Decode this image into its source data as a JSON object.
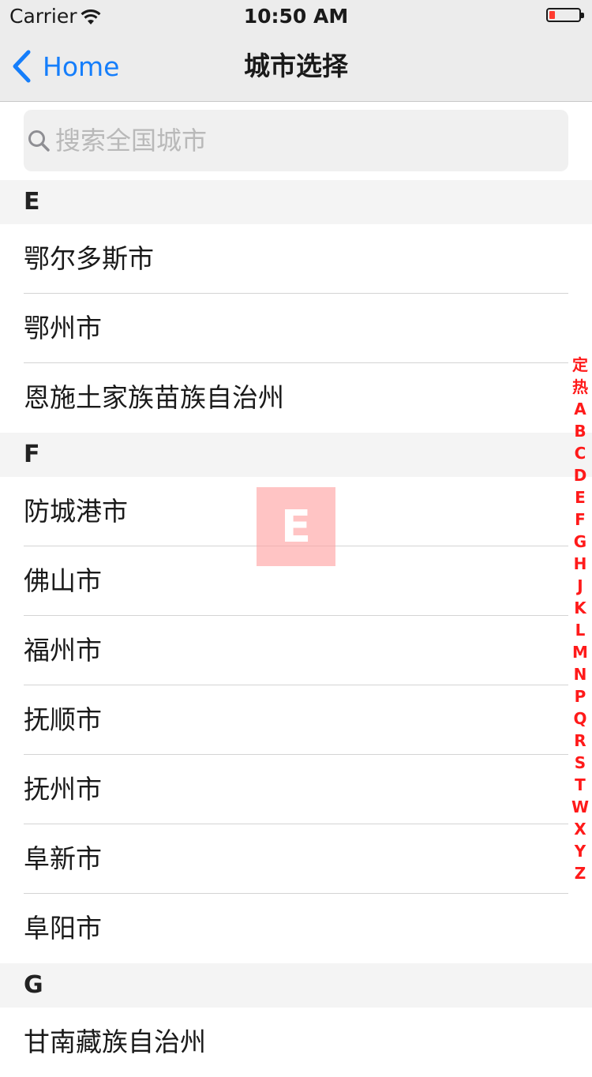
{
  "status_bar": {
    "carrier": "Carrier",
    "time": "10:50 AM",
    "battery_level_percent": 20,
    "battery_color": "#ff3b30"
  },
  "nav": {
    "back_label": "Home",
    "title": "城市选择",
    "accent_color": "#157efb"
  },
  "search": {
    "placeholder": "搜索全国城市",
    "value": ""
  },
  "sections": [
    {
      "letter": "E",
      "cities": [
        "鄂尔多斯市",
        "鄂州市",
        "恩施土家族苗族自治州"
      ]
    },
    {
      "letter": "F",
      "cities": [
        "防城港市",
        "佛山市",
        "福州市",
        "抚顺市",
        "抚州市",
        "阜新市",
        "阜阳市"
      ]
    },
    {
      "letter": "G",
      "cities": [
        "甘南藏族自治州"
      ]
    }
  ],
  "index": [
    "定",
    "热",
    "A",
    "B",
    "C",
    "D",
    "E",
    "F",
    "G",
    "H",
    "J",
    "K",
    "L",
    "M",
    "N",
    "P",
    "Q",
    "R",
    "S",
    "T",
    "W",
    "X",
    "Y",
    "Z"
  ],
  "index_color": "#ff1a1a",
  "overlay_letter": "E"
}
